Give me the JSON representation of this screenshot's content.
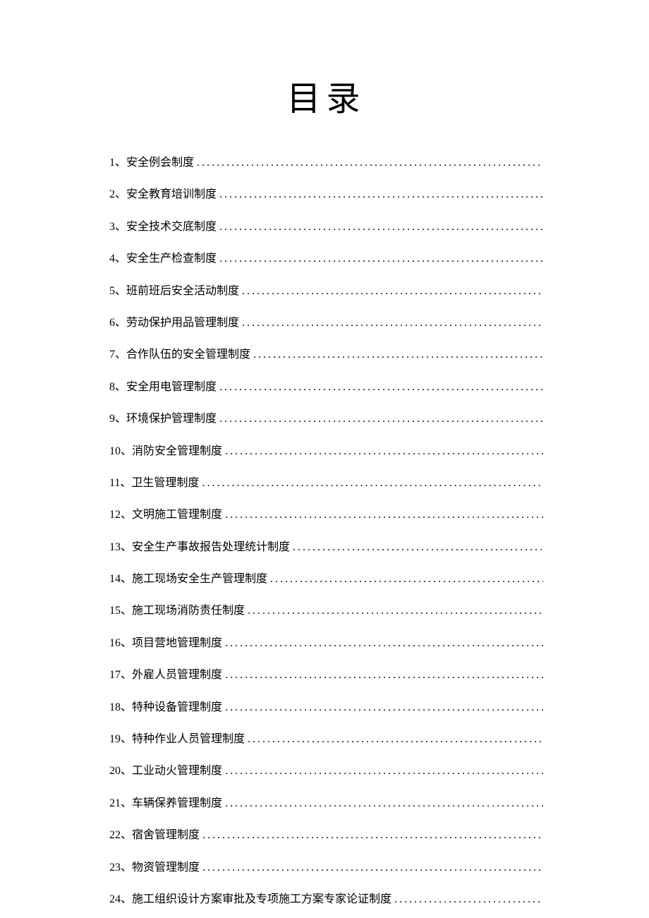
{
  "title": "目录",
  "toc": [
    {
      "number": "1、",
      "text": "安全例会制度"
    },
    {
      "number": "2、",
      "text": "安全教育培训制度"
    },
    {
      "number": "3、",
      "text": "安全技术交底制度"
    },
    {
      "number": "4、",
      "text": "安全生产检查制度"
    },
    {
      "number": "5、",
      "text": "班前班后安全活动制度"
    },
    {
      "number": "6、",
      "text": "劳动保护用品管理制度"
    },
    {
      "number": "7、",
      "text": "合作队伍的安全管理制度"
    },
    {
      "number": "8、",
      "text": "安全用电管理制度"
    },
    {
      "number": "9、",
      "text": "环境保护管理制度"
    },
    {
      "number": "10、",
      "text": "消防安全管理制度"
    },
    {
      "number": "11、",
      "text": "卫生管理制度"
    },
    {
      "number": "12、",
      "text": "文明施工管理制度"
    },
    {
      "number": "13、",
      "text": "安全生产事故报告处理统计制度"
    },
    {
      "number": "14、",
      "text": "施工现场安全生产管理制度"
    },
    {
      "number": "15、",
      "text": "施工现场消防责任制度"
    },
    {
      "number": "16、",
      "text": "项目营地管理制度"
    },
    {
      "number": "17、",
      "text": "外雇人员管理制度"
    },
    {
      "number": "18、",
      "text": "特种设备管理制度"
    },
    {
      "number": "19、",
      "text": "特种作业人员管理制度"
    },
    {
      "number": "20、",
      "text": "工业动火管理制度"
    },
    {
      "number": "21、",
      "text": "车辆保养管理制度"
    },
    {
      "number": "22、",
      "text": "宿舍管理制度"
    },
    {
      "number": "23、",
      "text": "物资管理制度"
    },
    {
      "number": "24、",
      "text": "施工组织设计方案审批及专项施工方案专家论证制度"
    }
  ]
}
